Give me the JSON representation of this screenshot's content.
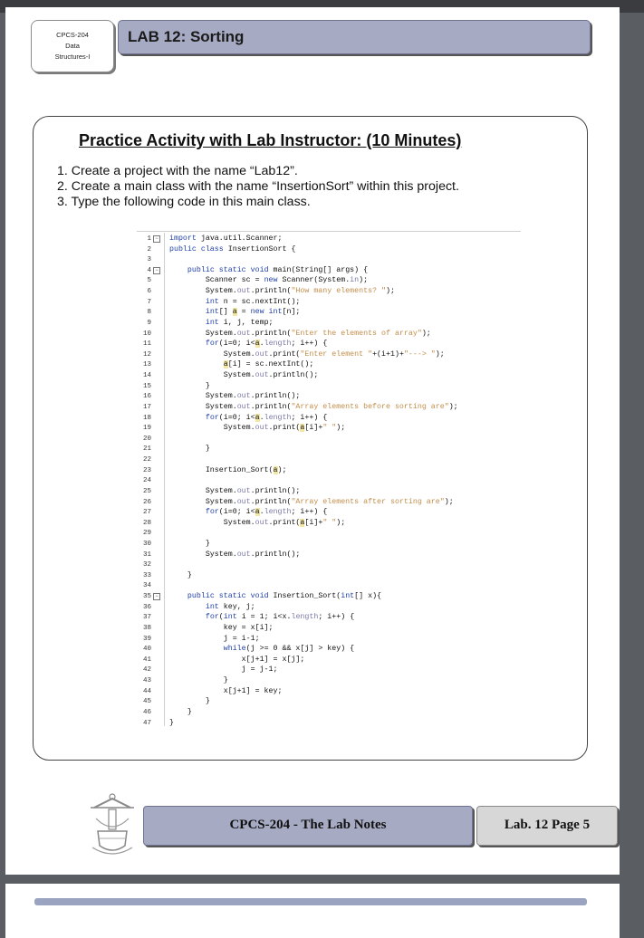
{
  "header": {
    "course_lines": [
      "CPCS-204",
      "Data",
      "Structures-I"
    ],
    "lab_title": "LAB 12: Sorting"
  },
  "activity": {
    "title": "Practice Activity with Lab Instructor: (10 Minutes)",
    "steps": [
      "1. Create a project with the name “Lab12”.",
      "2. Create a main class with the name “InsertionSort” within this project.",
      "3. Type the following code in this main class."
    ]
  },
  "code": {
    "lines": [
      {
        "n": "1",
        "fold": "−",
        "segs": [
          {
            "t": "import ",
            "c": "kw"
          },
          {
            "t": "java.util.Scanner;"
          }
        ]
      },
      {
        "n": "2",
        "segs": [
          {
            "t": "public class ",
            "c": "kw"
          },
          {
            "t": "InsertionSort {"
          }
        ]
      },
      {
        "n": "3",
        "segs": []
      },
      {
        "n": "4",
        "fold": "−",
        "segs": [
          {
            "t": "    "
          },
          {
            "t": "public static void ",
            "c": "kw"
          },
          {
            "t": "main(String[] args) {"
          }
        ]
      },
      {
        "n": "5",
        "segs": [
          {
            "t": "        Scanner sc = "
          },
          {
            "t": "new ",
            "c": "kw"
          },
          {
            "t": "Scanner(System."
          },
          {
            "t": "in",
            "c": "fld"
          },
          {
            "t": ");"
          }
        ]
      },
      {
        "n": "6",
        "segs": [
          {
            "t": "        System."
          },
          {
            "t": "out",
            "c": "fld"
          },
          {
            "t": ".println("
          },
          {
            "t": "\"How many elements? \"",
            "c": "str"
          },
          {
            "t": ");"
          }
        ]
      },
      {
        "n": "7",
        "segs": [
          {
            "t": "        "
          },
          {
            "t": "int ",
            "c": "kw"
          },
          {
            "t": "n = sc.nextInt();"
          }
        ]
      },
      {
        "n": "8",
        "segs": [
          {
            "t": "        "
          },
          {
            "t": "int",
            "c": "kw"
          },
          {
            "t": "[] "
          },
          {
            "t": "a",
            "c": "hl"
          },
          {
            "t": " = "
          },
          {
            "t": "new int",
            "c": "kw"
          },
          {
            "t": "[n];"
          }
        ]
      },
      {
        "n": "9",
        "segs": [
          {
            "t": "        "
          },
          {
            "t": "int ",
            "c": "kw"
          },
          {
            "t": "i, j, temp;"
          }
        ]
      },
      {
        "n": "10",
        "segs": [
          {
            "t": "        System."
          },
          {
            "t": "out",
            "c": "fld"
          },
          {
            "t": ".println("
          },
          {
            "t": "\"Enter the elements of array\"",
            "c": "str"
          },
          {
            "t": ");"
          }
        ]
      },
      {
        "n": "11",
        "segs": [
          {
            "t": "        "
          },
          {
            "t": "for",
            "c": "kw"
          },
          {
            "t": "(i=0; i<"
          },
          {
            "t": "a",
            "c": "hl"
          },
          {
            "t": "."
          },
          {
            "t": "length",
            "c": "fld"
          },
          {
            "t": "; i++) {"
          }
        ]
      },
      {
        "n": "12",
        "segs": [
          {
            "t": "            System."
          },
          {
            "t": "out",
            "c": "fld"
          },
          {
            "t": ".print("
          },
          {
            "t": "\"Enter element \"",
            "c": "str"
          },
          {
            "t": "+(i+1)+"
          },
          {
            "t": "\"---> \"",
            "c": "str"
          },
          {
            "t": ");"
          }
        ]
      },
      {
        "n": "13",
        "segs": [
          {
            "t": "            "
          },
          {
            "t": "a",
            "c": "hl"
          },
          {
            "t": "[i] = sc.nextInt();"
          }
        ]
      },
      {
        "n": "14",
        "segs": [
          {
            "t": "            System."
          },
          {
            "t": "out",
            "c": "fld"
          },
          {
            "t": ".println();"
          }
        ]
      },
      {
        "n": "15",
        "segs": [
          {
            "t": "        }"
          }
        ]
      },
      {
        "n": "16",
        "segs": [
          {
            "t": "        System."
          },
          {
            "t": "out",
            "c": "fld"
          },
          {
            "t": ".println();"
          }
        ]
      },
      {
        "n": "17",
        "segs": [
          {
            "t": "        System."
          },
          {
            "t": "out",
            "c": "fld"
          },
          {
            "t": ".println("
          },
          {
            "t": "\"Array elements before sorting are\"",
            "c": "str"
          },
          {
            "t": ");"
          }
        ]
      },
      {
        "n": "18",
        "segs": [
          {
            "t": "        "
          },
          {
            "t": "for",
            "c": "kw"
          },
          {
            "t": "(i=0; i<"
          },
          {
            "t": "a",
            "c": "hl"
          },
          {
            "t": "."
          },
          {
            "t": "length",
            "c": "fld"
          },
          {
            "t": "; i++) {"
          }
        ]
      },
      {
        "n": "19",
        "segs": [
          {
            "t": "            System."
          },
          {
            "t": "out",
            "c": "fld"
          },
          {
            "t": ".print("
          },
          {
            "t": "a",
            "c": "hl"
          },
          {
            "t": "[i]+"
          },
          {
            "t": "\" \"",
            "c": "str"
          },
          {
            "t": ");"
          }
        ]
      },
      {
        "n": "20",
        "segs": []
      },
      {
        "n": "21",
        "segs": [
          {
            "t": "        }"
          }
        ]
      },
      {
        "n": "22",
        "segs": []
      },
      {
        "n": "23",
        "segs": [
          {
            "t": "        Insertion_Sort("
          },
          {
            "t": "a",
            "c": "hl"
          },
          {
            "t": ");"
          }
        ]
      },
      {
        "n": "24",
        "segs": []
      },
      {
        "n": "25",
        "segs": [
          {
            "t": "        System."
          },
          {
            "t": "out",
            "c": "fld"
          },
          {
            "t": ".println();"
          }
        ]
      },
      {
        "n": "26",
        "segs": [
          {
            "t": "        System."
          },
          {
            "t": "out",
            "c": "fld"
          },
          {
            "t": ".println("
          },
          {
            "t": "\"Array elements after sorting are\"",
            "c": "str"
          },
          {
            "t": ");"
          }
        ]
      },
      {
        "n": "27",
        "segs": [
          {
            "t": "        "
          },
          {
            "t": "for",
            "c": "kw"
          },
          {
            "t": "(i=0; i<"
          },
          {
            "t": "a",
            "c": "hl"
          },
          {
            "t": "."
          },
          {
            "t": "length",
            "c": "fld"
          },
          {
            "t": "; i++) {"
          }
        ]
      },
      {
        "n": "28",
        "segs": [
          {
            "t": "            System."
          },
          {
            "t": "out",
            "c": "fld"
          },
          {
            "t": ".print("
          },
          {
            "t": "a",
            "c": "hl"
          },
          {
            "t": "[i]+"
          },
          {
            "t": "\" \"",
            "c": "str"
          },
          {
            "t": ");"
          }
        ]
      },
      {
        "n": "29",
        "segs": []
      },
      {
        "n": "30",
        "segs": [
          {
            "t": "        }"
          }
        ]
      },
      {
        "n": "31",
        "segs": [
          {
            "t": "        System."
          },
          {
            "t": "out",
            "c": "fld"
          },
          {
            "t": ".println();"
          }
        ]
      },
      {
        "n": "32",
        "segs": []
      },
      {
        "n": "33",
        "segs": [
          {
            "t": "    }"
          }
        ]
      },
      {
        "n": "34",
        "segs": []
      },
      {
        "n": "35",
        "fold": "−",
        "segs": [
          {
            "t": "    "
          },
          {
            "t": "public static void ",
            "c": "kw"
          },
          {
            "t": "Insertion_Sort("
          },
          {
            "t": "int",
            "c": "kw"
          },
          {
            "t": "[] x){"
          }
        ]
      },
      {
        "n": "36",
        "segs": [
          {
            "t": "        "
          },
          {
            "t": "int ",
            "c": "kw"
          },
          {
            "t": "key, j;"
          }
        ]
      },
      {
        "n": "37",
        "segs": [
          {
            "t": "        "
          },
          {
            "t": "for",
            "c": "kw"
          },
          {
            "t": "("
          },
          {
            "t": "int ",
            "c": "kw"
          },
          {
            "t": "i = 1; i<x."
          },
          {
            "t": "length",
            "c": "fld"
          },
          {
            "t": "; i++) {"
          }
        ]
      },
      {
        "n": "38",
        "segs": [
          {
            "t": "            key = x[i];"
          }
        ]
      },
      {
        "n": "39",
        "segs": [
          {
            "t": "            j = i-1;"
          }
        ]
      },
      {
        "n": "40",
        "segs": [
          {
            "t": "            "
          },
          {
            "t": "while",
            "c": "kw"
          },
          {
            "t": "(j >= 0 && x[j] > key) {"
          }
        ]
      },
      {
        "n": "41",
        "segs": [
          {
            "t": "                x[j+1] = x[j];"
          }
        ]
      },
      {
        "n": "42",
        "segs": [
          {
            "t": "                j = j-1;"
          }
        ]
      },
      {
        "n": "43",
        "segs": [
          {
            "t": "            }"
          }
        ]
      },
      {
        "n": "44",
        "segs": [
          {
            "t": "            x[j+1] = key;"
          }
        ]
      },
      {
        "n": "45",
        "segs": [
          {
            "t": "        }"
          }
        ]
      },
      {
        "n": "46",
        "segs": [
          {
            "t": "    }"
          }
        ]
      },
      {
        "n": "47",
        "segs": [
          {
            "t": "}"
          }
        ]
      }
    ]
  },
  "footer": {
    "notes": "CPCS-204 - The Lab Notes",
    "page": "Lab. 12 Page 5"
  }
}
